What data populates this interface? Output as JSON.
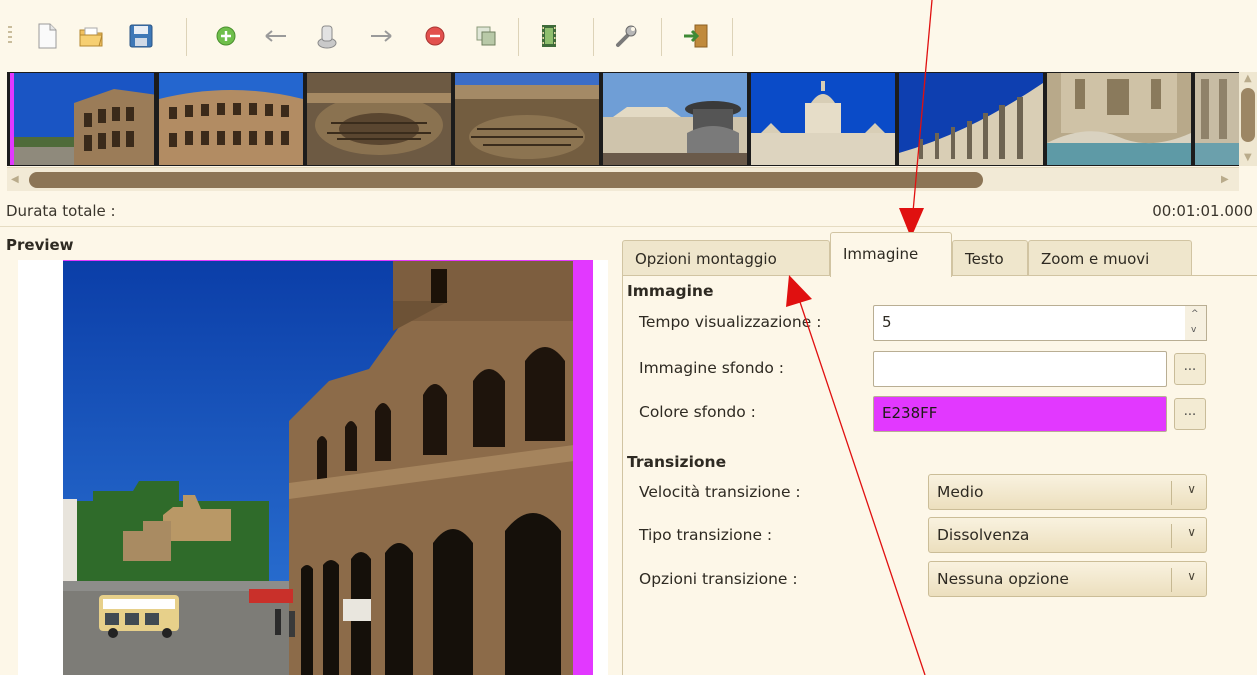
{
  "toolbar": {
    "buttons": [
      "new-document",
      "open-folder",
      "save",
      "add",
      "move-left",
      "import",
      "move-right",
      "remove",
      "copy",
      "film",
      "settings",
      "export"
    ]
  },
  "timeline": {
    "thumb_count": 9
  },
  "status": {
    "duration_label": "Durata totale :",
    "duration_value": "00:01:01.000"
  },
  "preview": {
    "title": "Preview",
    "background_color": "#e238ff"
  },
  "tabs": [
    {
      "label": "Opzioni montaggio",
      "active": false
    },
    {
      "label": "Immagine",
      "active": true
    },
    {
      "label": "Testo",
      "active": false
    },
    {
      "label": "Zoom e muovi",
      "active": false
    }
  ],
  "immagine": {
    "section_title": "Immagine",
    "display_time_label": "Tempo visualizzazione :",
    "display_time_value": "5",
    "bg_image_label": "Immagine sfondo :",
    "bg_image_value": "",
    "bg_color_label": "Colore sfondo :",
    "bg_color_value": "E238FF",
    "browse_label": "..."
  },
  "transizione": {
    "section_title": "Transizione",
    "speed_label": "Velocità transizione :",
    "speed_value": "Medio",
    "type_label": "Tipo transizione :",
    "type_value": "Dissolvenza",
    "options_label": "Opzioni transizione :",
    "options_value": "Nessuna opzione"
  },
  "colors": {
    "accent": "#e238ff",
    "annotation_arrows": "#e01010"
  }
}
